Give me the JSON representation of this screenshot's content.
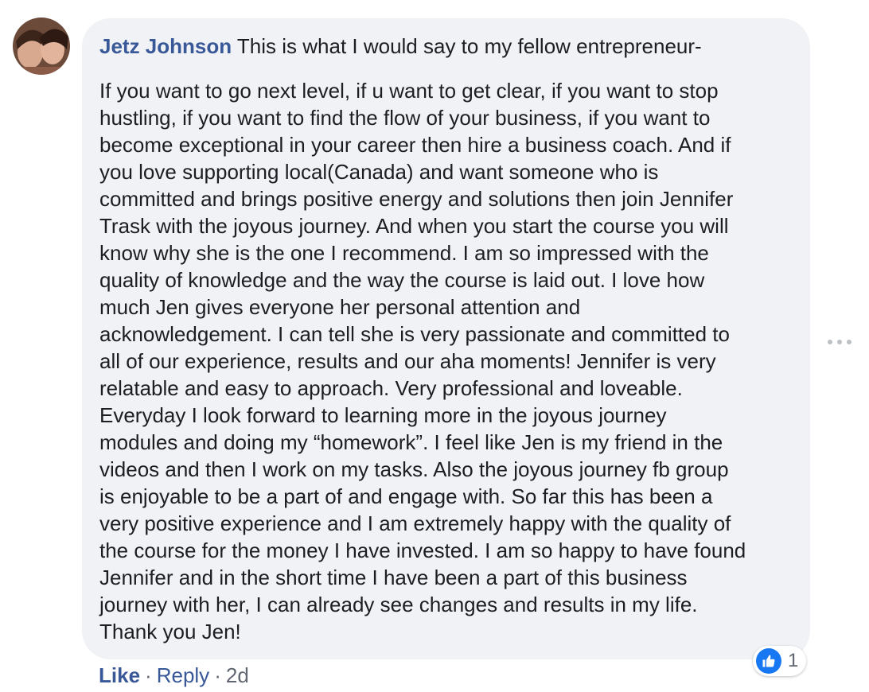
{
  "comment": {
    "author": "Jetz Johnson",
    "intro": "This is what I would say to my fellow entrepreneur-",
    "lines": [
      "If you want to go next level, if u want to get clear, if you want to stop",
      "hustling, if you want to find the flow of your business, if you want to",
      "become exceptional in your career then hire a business coach. And if",
      "you love supporting local(Canada) and want someone who is",
      "committed and brings positive energy and solutions then join Jennifer",
      "Trask with the joyous journey. And when you start the course you will",
      "know why she is the one I recommend. I am so impressed with the",
      "quality of knowledge and the way the course is laid out. I love how",
      "much Jen gives everyone her personal attention and",
      "acknowledgement. I can tell she is very passionate and committed to",
      "all of our experience, results and our aha moments! Jennifer is very",
      "relatable and easy to approach. Very professional and loveable.",
      "Everyday I look forward to learning more in the joyous journey",
      "modules and doing my “homework”. I feel like Jen is my friend in the",
      "videos and then I work on my tasks. Also the joyous journey fb group",
      "is enjoyable to be a part of and engage with. So far this has been a",
      "very positive experience and I am extremely happy with the quality of",
      "the course for the money I have invested. I am so happy to have found",
      "Jennifer and in the short time I have been a part of this business",
      "journey with her, I can already see changes and results in my life.",
      "Thank you Jen!"
    ]
  },
  "actions": {
    "like_label": "Like",
    "separator": "·",
    "reply_label": "Reply",
    "timestamp": "2d"
  },
  "reaction": {
    "icon": "thumbs-up-icon",
    "count": "1",
    "color": "#1877f2"
  },
  "colors": {
    "bubble_bg": "#f0f2f5",
    "author": "#385898",
    "meta": "#606770"
  }
}
